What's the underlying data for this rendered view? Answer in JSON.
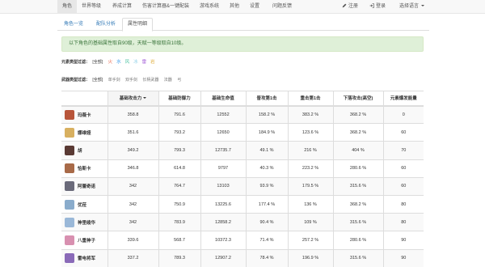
{
  "nav": {
    "items": [
      {
        "label": "角色"
      },
      {
        "label": "世界等级"
      },
      {
        "label": "养成计算"
      },
      {
        "label": "伤害计算器&一键配装"
      },
      {
        "label": "游戏系统"
      },
      {
        "label": "其他"
      },
      {
        "label": "设置"
      },
      {
        "label": "问题反馈"
      }
    ],
    "register": "注册",
    "login": "登录",
    "language": "选择语言"
  },
  "tabs": [
    {
      "label": "角色一览"
    },
    {
      "label": "配队分析"
    },
    {
      "label": "属性明细"
    }
  ],
  "notice": "以下角色的基础属性取自90级，天赋一等级取自10级。",
  "filters": {
    "element_label": "元素类型过滤：",
    "element_all": "[全部]",
    "elements": [
      {
        "glyph": "火",
        "color": "#e8583a"
      },
      {
        "glyph": "水",
        "color": "#3a9be8"
      },
      {
        "glyph": "风",
        "color": "#4cc2a2"
      },
      {
        "glyph": "冰",
        "color": "#8fd0e8"
      },
      {
        "glyph": "雷",
        "color": "#a35fd8"
      },
      {
        "glyph": "岩",
        "color": "#e0b040"
      }
    ],
    "weapon_label": "武器类型过滤：",
    "weapon_all": "[全部]",
    "weapons": [
      "单手剑",
      "双手剑",
      "长柄武器",
      "法器",
      "弓"
    ]
  },
  "table": {
    "headers": [
      "",
      "基础攻击力",
      "基础防御力",
      "基础生命值",
      "普攻第1击",
      "重击第1击",
      "下落攻击(高空)",
      "元素爆发能量"
    ],
    "rows": [
      {
        "name": "玛薇卡",
        "avatar": "#b8553a",
        "cells": [
          "358.8",
          "791.6",
          "12552",
          "158.2 %",
          "383.2 %",
          "368.2 %",
          "0"
        ]
      },
      {
        "name": "娜维娅",
        "avatar": "#d8b060",
        "cells": [
          "351.6",
          "793.2",
          "12650",
          "184.9 %",
          "123.6 %",
          "368.2 %",
          "60"
        ]
      },
      {
        "name": "胡",
        "avatar": "#5a3a34",
        "cells": [
          "349.2",
          "799.3",
          "12735.7",
          "49.1 %",
          "216 %",
          "404 %",
          "70"
        ]
      },
      {
        "name": "恰斯卡",
        "avatar": "#a86a48",
        "cells": [
          "346.8",
          "614.8",
          "9797",
          "40.3 %",
          "223.2 %",
          "280.6 %",
          "60"
        ]
      },
      {
        "name": "阿蕾奇诺",
        "avatar": "#6a6a7a",
        "cells": [
          "342",
          "764.7",
          "13103",
          "93.9 %",
          "179.5 %",
          "315.6 %",
          "60"
        ]
      },
      {
        "name": "优菈",
        "avatar": "#8aaccc",
        "cells": [
          "342",
          "750.9",
          "13225.6",
          "177.4 %",
          "136 %",
          "368.2 %",
          "80"
        ]
      },
      {
        "name": "神里绫华",
        "avatar": "#9ab8d8",
        "cells": [
          "342",
          "783.9",
          "12858.2",
          "90.4 %",
          "109 %",
          "315.6 %",
          "80"
        ]
      },
      {
        "name": "八重神子",
        "avatar": "#d890b0",
        "cells": [
          "339.6",
          "568.7",
          "10372.3",
          "71.4 %",
          "257.2 %",
          "280.6 %",
          "90"
        ]
      },
      {
        "name": "雷电将军",
        "avatar": "#8a6ab8",
        "cells": [
          "337.2",
          "789.3",
          "12907.2",
          "78.4 %",
          "196.9 %",
          "315.6 %",
          "90"
        ]
      }
    ]
  }
}
